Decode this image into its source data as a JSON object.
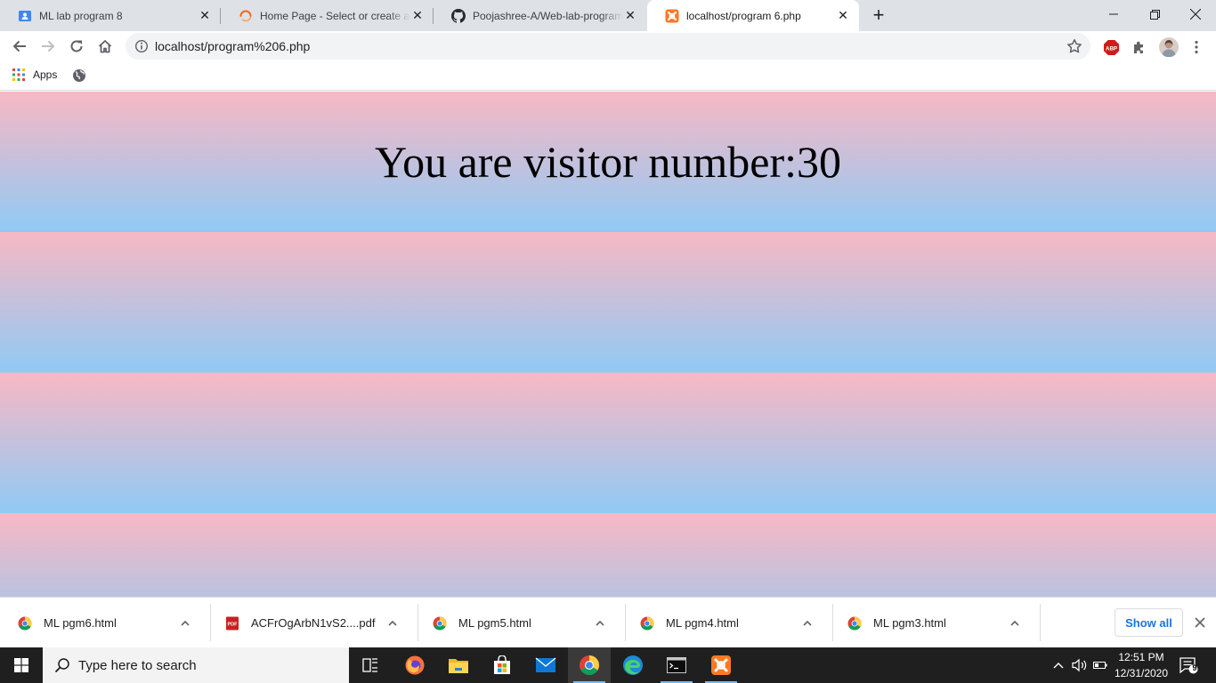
{
  "browser": {
    "tabs": [
      {
        "title": "ML lab program 8",
        "icon": "google-classroom-icon",
        "active": false
      },
      {
        "title": "Home Page - Select or create a n",
        "icon": "loading-spinner-icon",
        "active": false
      },
      {
        "title": "Poojashree-A/Web-lab-programs",
        "icon": "github-icon",
        "active": false
      },
      {
        "title": "localhost/program 6.php",
        "icon": "xampp-icon",
        "active": true
      }
    ],
    "address": "localhost/program%206.php",
    "bookmarks": {
      "apps_label": "Apps"
    }
  },
  "page": {
    "visitor_text": "You are visitor number:30",
    "band_colors": {
      "top": "#f8b8c4",
      "bottom": "#90caf5"
    }
  },
  "downloads": {
    "items": [
      {
        "name": "ML pgm6.html",
        "icon": "chrome-file-icon"
      },
      {
        "name": "ACFrOgArbN1vS2....pdf",
        "icon": "pdf-icon"
      },
      {
        "name": "ML pgm5.html",
        "icon": "chrome-file-icon"
      },
      {
        "name": "ML pgm4.html",
        "icon": "chrome-file-icon"
      },
      {
        "name": "ML pgm3.html",
        "icon": "chrome-file-icon"
      }
    ],
    "show_all_label": "Show all"
  },
  "taskbar": {
    "search_placeholder": "Type here to search",
    "time": "12:51 PM",
    "date": "12/31/2020",
    "notification_count": "9",
    "pinned": [
      "task-view-icon",
      "firefox-icon",
      "file-explorer-icon",
      "store-icon",
      "mail-icon",
      "chrome-icon",
      "edge-icon",
      "terminal-icon",
      "xampp-icon"
    ]
  }
}
